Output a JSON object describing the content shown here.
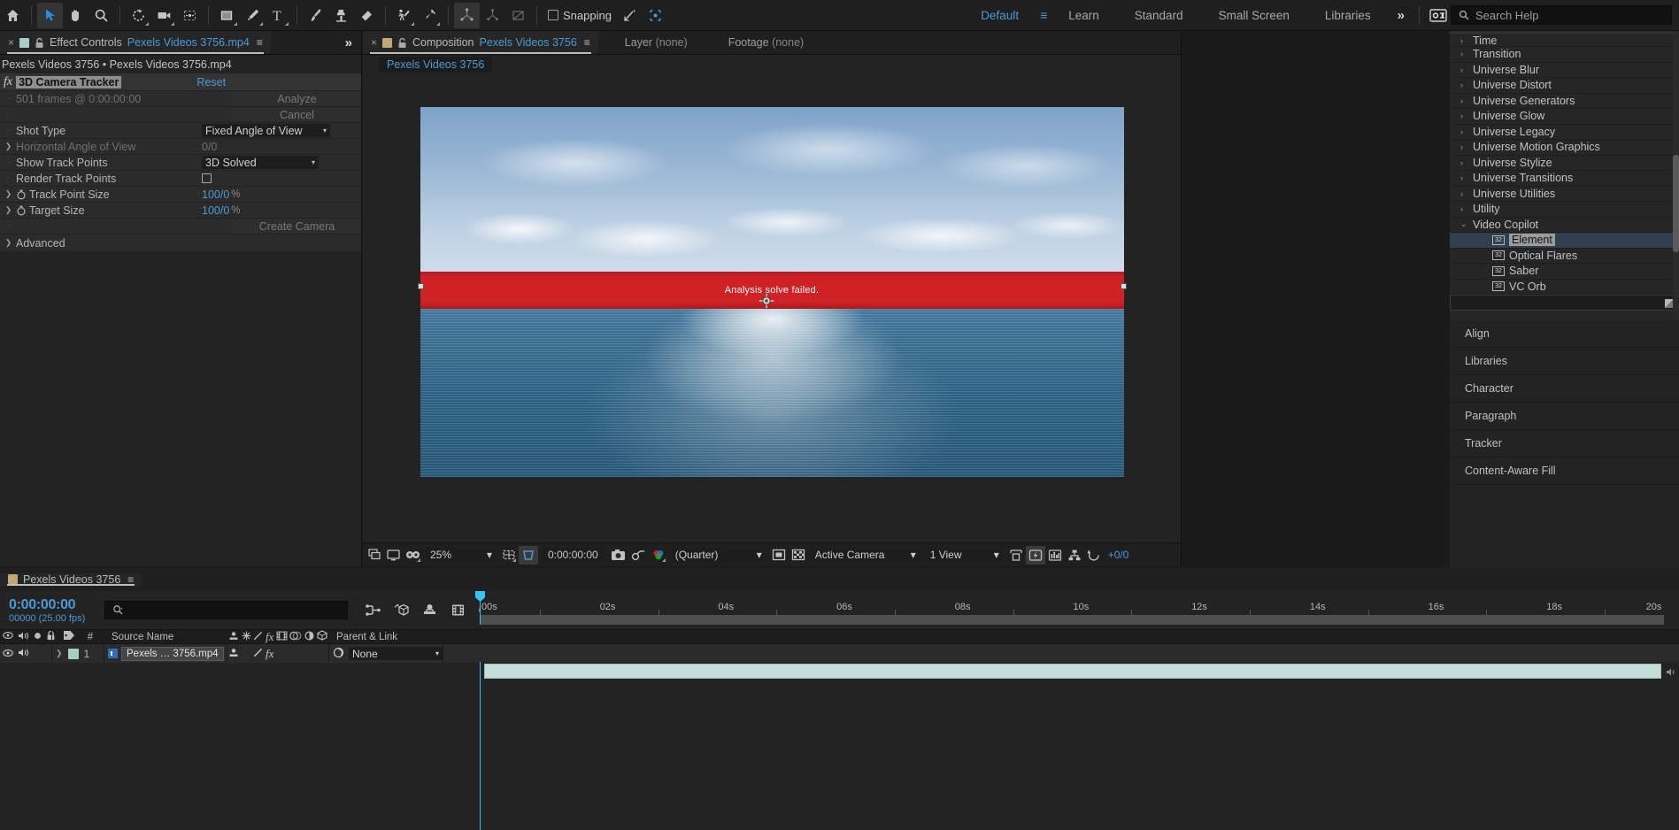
{
  "app": {
    "accent_blue": "#4a9ad4",
    "panel_bg": "#232323",
    "error_red": "#cf2024"
  },
  "toolbar": {
    "tools": [
      {
        "name": "home-icon",
        "label": "Home"
      },
      {
        "name": "selection-tool-icon",
        "label": "Selection Tool",
        "selected": true
      },
      {
        "name": "hand-tool-icon",
        "label": "Hand Tool"
      },
      {
        "name": "zoom-tool-icon",
        "label": "Zoom Tool"
      },
      {
        "name": "rotation-tool-icon",
        "label": "Rotation Tool"
      },
      {
        "name": "camera-tool-icon",
        "label": "Unified Camera Tool"
      },
      {
        "name": "anchor-point-tool-icon",
        "label": "Pan Behind Tool"
      },
      {
        "name": "shape-tool-icon",
        "label": "Rectangle Tool"
      },
      {
        "name": "pen-tool-icon",
        "label": "Pen Tool"
      },
      {
        "name": "type-tool-icon",
        "label": "Type Tool"
      },
      {
        "name": "brush-tool-icon",
        "label": "Brush Tool"
      },
      {
        "name": "clone-stamp-tool-icon",
        "label": "Clone Stamp Tool"
      },
      {
        "name": "eraser-tool-icon",
        "label": "Eraser Tool"
      },
      {
        "name": "roto-brush-tool-icon",
        "label": "Roto Brush Tool"
      },
      {
        "name": "puppet-pin-tool-icon",
        "label": "Puppet Pin Tool"
      }
    ],
    "rig_tools": [
      {
        "name": "local-axis-mode-icon",
        "label": "Local Axis Mode",
        "selected": true
      },
      {
        "name": "world-axis-mode-icon",
        "label": "World Axis Mode"
      },
      {
        "name": "view-axis-mode-icon",
        "label": "View Axis Mode"
      }
    ],
    "snapping_label": "Snapping",
    "snapping_checked": false,
    "snap_extras": [
      {
        "name": "snap-to-feature-icon"
      },
      {
        "name": "snap-align-icon"
      }
    ],
    "workspaces": [
      {
        "label": "Default",
        "active": true
      },
      {
        "label": "Learn",
        "active": false
      },
      {
        "label": "Standard",
        "active": false
      },
      {
        "label": "Small Screen",
        "active": false
      },
      {
        "label": "Libraries",
        "active": false
      }
    ],
    "overflow_label": "»",
    "search": {
      "placeholder": "Search Help",
      "value": ""
    }
  },
  "effect_controls": {
    "tab": {
      "close_label": "×",
      "title": "Effect Controls",
      "file_name": "Pexels Videos 3756.mp4",
      "swatch_color": "#a8ccc6",
      "menu_label": "≡",
      "overflow_label": "»"
    },
    "subtitle": "Pexels Videos 3756 • Pexels Videos 3756.mp4",
    "effect": {
      "name": "3D Camera Tracker",
      "reset_label": "Reset",
      "fx_label": "fx"
    },
    "rows": [
      {
        "label": "501 frames @ 0:00:00:00",
        "dim_label": true,
        "value": "Analyze",
        "kind": "button-dim",
        "marker": "dot"
      },
      {
        "label": "",
        "dim_label": true,
        "value": "Cancel",
        "kind": "button-dim",
        "marker": "dot"
      },
      {
        "label": "Shot Type",
        "dim_label": false,
        "value": "Fixed Angle of View",
        "kind": "dropdown",
        "marker": "dot"
      },
      {
        "label": "Horizontal Angle of View",
        "dim_label": true,
        "value": "0/0",
        "kind": "dim-text",
        "marker": "arrow"
      },
      {
        "label": "Show Track Points",
        "dim_label": false,
        "value": "3D Solved",
        "kind": "dropdown2",
        "marker": "dot"
      },
      {
        "label": "Render Track Points",
        "dim_label": false,
        "value": "",
        "kind": "checkbox",
        "marker": "dot"
      },
      {
        "label": "Track Point Size",
        "dim_label": false,
        "value": "100/0",
        "unit": "%",
        "kind": "blue-value",
        "marker": "arrow",
        "stopwatch": true
      },
      {
        "label": "Target Size",
        "dim_label": false,
        "value": "100/0",
        "unit": "%",
        "kind": "blue-value",
        "marker": "arrow",
        "stopwatch": true
      },
      {
        "label": "",
        "dim_label": true,
        "value": "Create Camera",
        "kind": "button-dim",
        "marker": "dot"
      },
      {
        "label": "Advanced",
        "dim_label": false,
        "value": "",
        "kind": "group",
        "marker": "arrow"
      }
    ]
  },
  "composition": {
    "tab": {
      "close_label": "×",
      "title": "Composition",
      "comp_name": "Pexels Videos 3756",
      "swatch_color": "#c2a878",
      "menu_label": "≡"
    },
    "layer_label": "Layer",
    "layer_value": "(none)",
    "footage_label": "Footage",
    "footage_value": "(none)",
    "breadcrumb": "Pexels Videos 3756",
    "viewer": {
      "error_message": "Analysis solve failed.",
      "cursor_name": "3d-camera-tracker-target-cursor"
    },
    "bottom_bar": {
      "toggles": [
        {
          "name": "always-preview-icon"
        },
        {
          "name": "toggle-transparency-grid-icon"
        },
        {
          "name": "3d-glasses-icon"
        }
      ],
      "zoom_level": "25%",
      "grid_icons": [
        {
          "name": "grid-guides-icon",
          "on": false
        },
        {
          "name": "region-of-interest-icon",
          "on": true
        }
      ],
      "current_time": "0:00:00:00",
      "snapshot_icons": [
        {
          "name": "camera-snapshot-icon"
        },
        {
          "name": "show-snapshot-icon"
        },
        {
          "name": "show-channel-icon"
        }
      ],
      "resolution": "(Quarter)",
      "mask_icons": [
        {
          "name": "toggle-mask-visibility-icon",
          "on": false
        },
        {
          "name": "transparency-grid-icon",
          "on": false
        }
      ],
      "camera_view": "Active Camera",
      "view_layout": "1 View",
      "extra_icons": [
        {
          "name": "pixel-aspect-correction-icon"
        },
        {
          "name": "fast-previews-icon",
          "on": true
        },
        {
          "name": "timeline-flowchart-icon"
        },
        {
          "name": "comp-flowchart-icon"
        },
        {
          "name": "reset-exposure-icon"
        }
      ],
      "exposure": "+0/0"
    }
  },
  "effects_presets": {
    "items": [
      {
        "label": "Time",
        "indent": 0,
        "twisty": "›",
        "partial": true
      },
      {
        "label": "Transition",
        "indent": 0,
        "twisty": "›"
      },
      {
        "label": "Universe Blur",
        "indent": 0,
        "twisty": "›"
      },
      {
        "label": "Universe Distort",
        "indent": 0,
        "twisty": "›"
      },
      {
        "label": "Universe Generators",
        "indent": 0,
        "twisty": "›"
      },
      {
        "label": "Universe Glow",
        "indent": 0,
        "twisty": "›"
      },
      {
        "label": "Universe Legacy",
        "indent": 0,
        "twisty": "›"
      },
      {
        "label": "Universe Motion Graphics",
        "indent": 0,
        "twisty": "›"
      },
      {
        "label": "Universe Stylize",
        "indent": 0,
        "twisty": "›"
      },
      {
        "label": "Universe Transitions",
        "indent": 0,
        "twisty": "›"
      },
      {
        "label": "Universe Utilities",
        "indent": 0,
        "twisty": "›"
      },
      {
        "label": "Utility",
        "indent": 0,
        "twisty": "›"
      },
      {
        "label": "Video Copilot",
        "indent": 0,
        "twisty": "⌄",
        "expanded": true
      },
      {
        "label": "Element",
        "indent": 1,
        "badge": "32",
        "selected": true
      },
      {
        "label": "Optical Flares",
        "indent": 1,
        "badge": "32"
      },
      {
        "label": "Saber",
        "indent": 1,
        "badge": "32"
      },
      {
        "label": "VC Orb",
        "indent": 1,
        "badge": "32"
      }
    ],
    "panels": [
      {
        "label": "Align"
      },
      {
        "label": "Libraries"
      },
      {
        "label": "Character"
      },
      {
        "label": "Paragraph"
      },
      {
        "label": "Tracker"
      },
      {
        "label": "Content-Aware Fill"
      }
    ]
  },
  "timeline": {
    "tab": {
      "comp_name": "Pexels Videos 3756",
      "swatch_color": "#c2a878",
      "menu_label": "≡"
    },
    "current_time": "0:00:00:00",
    "frame_info": "00000 (25.00 fps)",
    "search_placeholder": "",
    "toolbar_icons": [
      {
        "name": "composition-mini-flowchart-icon"
      },
      {
        "name": "draft-3d-icon"
      },
      {
        "name": "hide-shy-layers-icon"
      },
      {
        "name": "frame-blending-icon"
      },
      {
        "name": "motion-blur-icon"
      },
      {
        "name": "graph-editor-icon"
      }
    ],
    "columns": {
      "video_icon": "eye-icon",
      "audio_icon": "speaker-icon",
      "solo_icon": "solo-dot-icon",
      "lock_icon": "lock-icon",
      "label_icon": "label-tag-icon",
      "index": "#",
      "source_name": "Source Name",
      "switch_icons": [
        "shy-icon",
        "collapse-icon",
        "quality-icon",
        "effects-icon",
        "frame-blend-icon",
        "motion-blur-icon",
        "adjustment-icon",
        "3d-layer-icon"
      ],
      "parent_link": "Parent & Link"
    },
    "layers": [
      {
        "index": "1",
        "source_name": "Pexels … 3756.mp4",
        "label_color": "#a8ccc6",
        "parent": "None",
        "visible": true,
        "audio": true,
        "has_effects": true,
        "clip_color": "#c5ddd7"
      }
    ],
    "ruler_ticks": [
      "00s",
      "02s",
      "04s",
      "06s",
      "08s",
      "10s",
      "12s",
      "14s",
      "16s",
      "18s",
      "20s"
    ],
    "playhead_time": "00s"
  }
}
